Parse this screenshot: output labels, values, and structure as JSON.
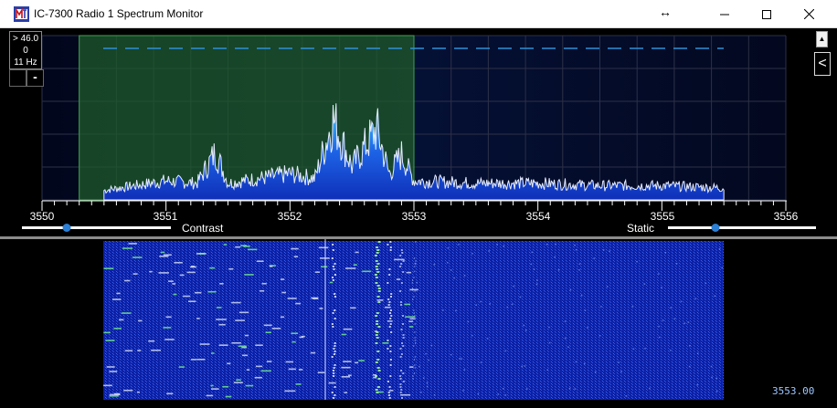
{
  "window": {
    "title": "IC-7300 Radio 1 Spectrum Monitor",
    "resize_glyph": "↔",
    "icons": [
      "app-icon",
      "minimize-icon",
      "maximize-icon",
      "close-icon"
    ]
  },
  "readout": {
    "ref_level": "> 46.0",
    "span_value": "0",
    "rbw": "11 Hz"
  },
  "controls": {
    "minus_label": "-",
    "collapse_label": "<",
    "scroll_up_label": "▲",
    "contrast_label": "Contrast",
    "static_label": "Static",
    "contrast_value": 0.3,
    "static_value": 0.32
  },
  "axis": {
    "tick_labels": [
      "3550",
      "3551",
      "3552",
      "3553",
      "3554",
      "3555",
      "3556"
    ]
  },
  "colors": {
    "passband": "#1f5a2a",
    "spectrum_fill": "#1547d6",
    "spectrum_line": "#e6ecff",
    "waterfall_bg": "#0b1fa3",
    "grid": "#2c3147"
  },
  "waterfall": {
    "center_frequency": "3553.00"
  },
  "chart_data": {
    "type": "area",
    "xlabel": "",
    "ylabel": "",
    "xlim": [
      3550,
      3556
    ],
    "passband": [
      3550.3,
      3553.0
    ],
    "x": [
      3550.5,
      3550.75,
      3551.0,
      3551.25,
      3551.4,
      3551.5,
      3551.75,
      3552.0,
      3552.2,
      3552.35,
      3552.5,
      3552.7,
      3552.8,
      3552.9,
      3553.0,
      3553.5,
      3554.0,
      3554.5,
      3555.0,
      3555.5
    ],
    "values": [
      8,
      12,
      16,
      14,
      40,
      14,
      18,
      22,
      18,
      68,
      28,
      60,
      22,
      38,
      16,
      14,
      14,
      12,
      12,
      10
    ],
    "ylim": [
      0,
      100
    ]
  }
}
